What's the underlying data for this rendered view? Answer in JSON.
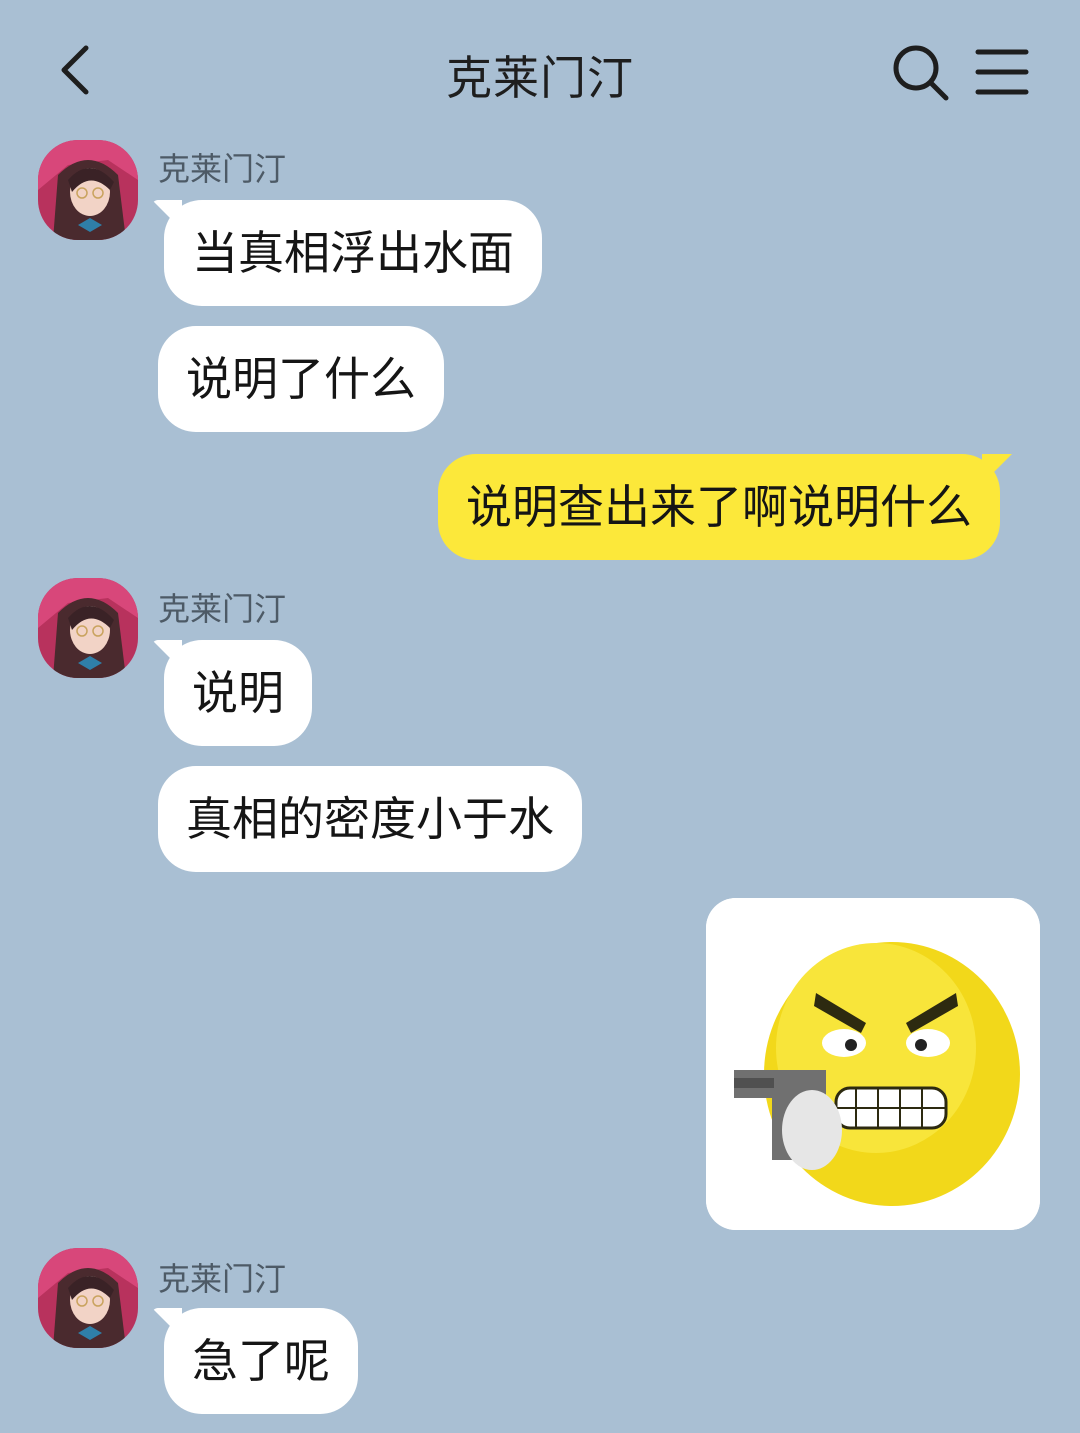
{
  "header": {
    "title": "克莱门汀"
  },
  "icons": {
    "back": "back-chevron-icon",
    "search": "search-icon",
    "menu": "menu-icon"
  },
  "colors": {
    "background": "#a9bfd3",
    "incoming_bubble": "#ffffff",
    "outgoing_bubble": "#fce83a"
  },
  "messages": [
    {
      "sender": "克莱门汀",
      "bubbles": [
        "当真相浮出水面",
        "说明了什么"
      ]
    },
    {
      "sender": "me",
      "bubbles": [
        "说明查出来了啊说明什么"
      ]
    },
    {
      "sender": "克莱门汀",
      "bubbles": [
        "说明",
        "真相的密度小于水"
      ]
    },
    {
      "sender": "me",
      "sticker": "angry-emoji-with-gun-sticker"
    },
    {
      "sender": "克莱门汀",
      "bubbles": [
        "急了呢"
      ]
    }
  ]
}
